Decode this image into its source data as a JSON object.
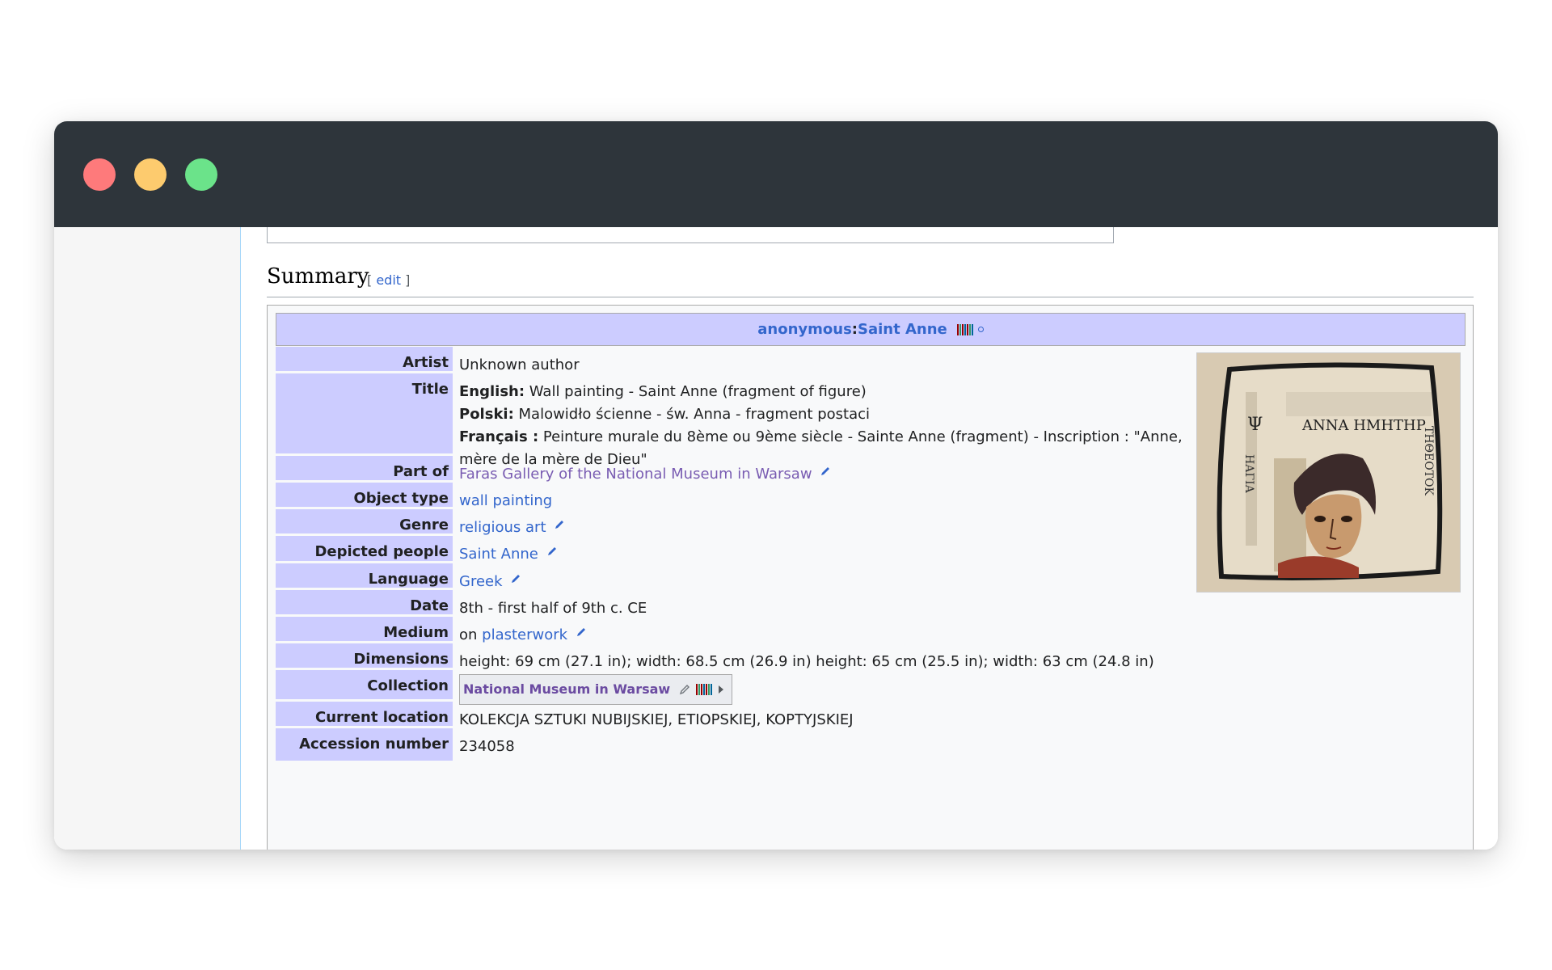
{
  "window": {
    "buttons": [
      "close",
      "minimize",
      "maximize"
    ]
  },
  "section": {
    "heading": "Summary",
    "edit_open": "[ ",
    "edit_label": "edit",
    "edit_close": " ]"
  },
  "infobox": {
    "header": {
      "artist": "anonymous",
      "separator": ": ",
      "title": "Saint Anne"
    },
    "rows": {
      "artist": {
        "label": "Artist",
        "value": "Unknown author"
      },
      "title": {
        "label": "Title",
        "english_lang": "English:",
        "english": " Wall painting - Saint Anne (fragment of figure)",
        "polski_lang": "Polski:",
        "polski": " Malowidło ścienne - św. Anna - fragment postaci",
        "francais_lang": "Français :",
        "francais_line1": " Peinture murale du 8ème ou 9ème siècle - Sainte Anne (fragment) - Inscription : \"Anne,",
        "francais_line2": "mère de la mère de Dieu\""
      },
      "part_of": {
        "label": "Part of",
        "value": "Faras Gallery of the National Museum in Warsaw"
      },
      "object_type": {
        "label": "Object type",
        "value": "wall painting"
      },
      "genre": {
        "label": "Genre",
        "value": "religious art"
      },
      "depicted": {
        "label": "Depicted people",
        "value": "Saint Anne"
      },
      "language": {
        "label": "Language",
        "value": "Greek"
      },
      "date": {
        "label": "Date",
        "value": "8th - first half of 9th c. CE"
      },
      "medium": {
        "label": "Medium",
        "prefix": "on ",
        "value": "plasterwork"
      },
      "dimensions": {
        "label": "Dimensions",
        "value": "height: 69 cm (27.1 in); width: 68.5 cm (26.9 in) height: 65 cm (25.5 in); width: 63 cm (24.8 in)"
      },
      "collection": {
        "label": "Collection",
        "value": "National Museum in Warsaw"
      },
      "location": {
        "label": "Current location",
        "value": "KOLEKCJA SZTUKI NUBIJSKIEJ, ETIOPSKIEJ, KOPTYJSKIEJ"
      },
      "accession": {
        "label": "Accession number",
        "value": "234058"
      }
    },
    "image": {
      "inscription_top": "ΑΝΝΑ ΗΜΗΤΗΡ",
      "inscription_left": "ΗΑΓΙΑ",
      "inscription_right": "ΤΗΘΕΟΤΟΚ"
    }
  }
}
